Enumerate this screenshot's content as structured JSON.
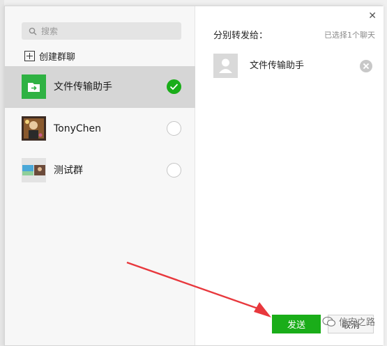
{
  "search": {
    "placeholder": "搜索"
  },
  "create_group": {
    "label": "创建群聊"
  },
  "contacts": [
    {
      "name": "文件传输助手",
      "selected": true
    },
    {
      "name": "TonyChen",
      "selected": false
    },
    {
      "name": "测试群",
      "selected": false
    }
  ],
  "right_panel": {
    "title": "分别转发给：",
    "count_text": "已选择1个聊天",
    "selected": [
      {
        "name": "文件传输助手"
      }
    ]
  },
  "buttons": {
    "send": "发送",
    "cancel": "取消"
  },
  "watermark": {
    "text": "信安之路"
  },
  "colors": {
    "accent": "#1aad19",
    "arrow": "#e8383d"
  }
}
